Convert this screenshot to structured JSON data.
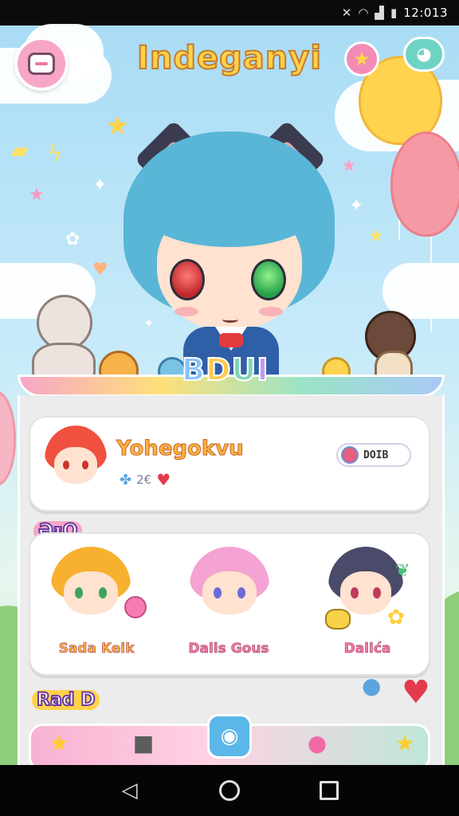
{
  "status_bar": {
    "time": "12:013",
    "icons": [
      "mute-icon",
      "wifi-icon",
      "signal-icon",
      "battery-icon"
    ]
  },
  "header": {
    "title": "Indeganyi",
    "menu_icon": "menu-icon",
    "flower_icon": "flower-icon",
    "bird_icon": "bird-icon"
  },
  "hero": {
    "badge_text": [
      "B",
      "D",
      "U",
      "I"
    ]
  },
  "profile_card": {
    "name": "Yohegokvu",
    "meta_text": "2€",
    "pill_text": "DOIB"
  },
  "friends_section": {
    "tag": "ƏᵻO",
    "friends": [
      {
        "name": "Sada Keik"
      },
      {
        "name": "Dalis Gous"
      },
      {
        "name": "Dalića"
      }
    ]
  },
  "bottom_section": {
    "tag": "Rad D"
  },
  "bottom_nav": {
    "items": [
      {
        "icon": "star-icon"
      },
      {
        "icon": "cat-icon"
      },
      {
        "icon": "chat-icon"
      },
      {
        "icon": "pig-icon"
      },
      {
        "icon": "star-icon"
      }
    ]
  },
  "colors": {
    "title_fill": "#ffd24a",
    "accent_pink": "#f7a6c8",
    "accent_teal": "#6fd3c4",
    "panel_bg": "#ececec"
  }
}
